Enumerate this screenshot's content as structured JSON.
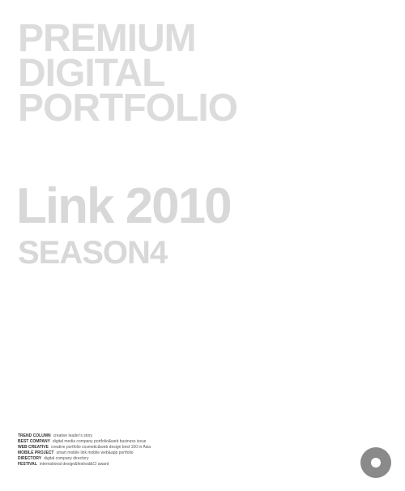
{
  "headline": {
    "line1": "PREMIUM",
    "line2": "DIGITAL",
    "line3": "PORTFOLIO"
  },
  "brand": {
    "title": "Link 2010",
    "subtitle": "SEASON4"
  },
  "toc": [
    {
      "key": "TREND COLUMN",
      "text": "creative leader's story"
    },
    {
      "key": "BEST COMPANY",
      "text": "digital media company portfolio&web business issue"
    },
    {
      "key": "WEB CREATIVE",
      "text": "creative portfolio cosmetic&web design best 100 in Asia"
    },
    {
      "key": "MOBILE PROJECT",
      "text": "smart mobile link mobile web&app portfolio"
    },
    {
      "key": "DIRECTORY",
      "text": "digital company directory"
    },
    {
      "key": "FESTIVAL",
      "text": "international design&festival&CI award"
    }
  ],
  "colors": {
    "headline": "#dcdcdc",
    "brand": "#d8d8d8",
    "logo": "#8a8a8a"
  },
  "icons": {
    "logo": "ring-logo-icon"
  }
}
